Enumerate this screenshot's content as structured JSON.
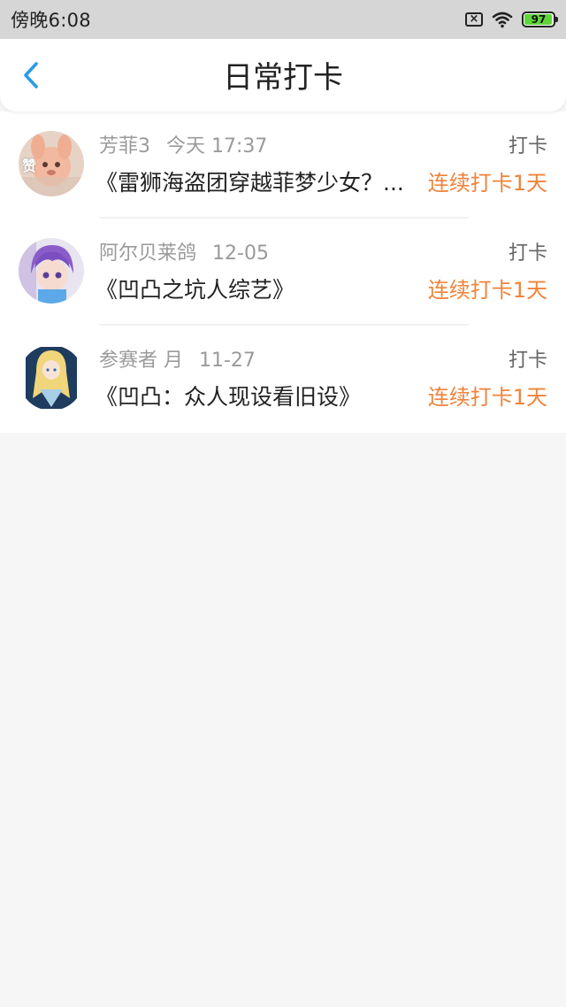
{
  "status_bar": {
    "time": "傍晚6:08",
    "battery_level": "97",
    "battery_fraction": 0.97
  },
  "header": {
    "title": "日常打卡",
    "back_icon": "chevron-left-icon",
    "accent_color": "#2a9be8"
  },
  "items": [
    {
      "user": "芳菲3",
      "date": "今天 17:37",
      "action": "打卡",
      "title": "《雷狮海盗团穿越菲梦少女？...",
      "streak": "连续打卡1天",
      "avatar_badge": "赞"
    },
    {
      "user": "阿尔贝莱鸽",
      "date": "12-05",
      "action": "打卡",
      "title": "《凹凸之坑人综艺》",
      "streak": "连续打卡1天"
    },
    {
      "user": "参赛者 月",
      "date": "11-27",
      "action": "打卡",
      "title": "《凹凸：众人现设看旧设》",
      "streak": "连续打卡1天"
    }
  ],
  "colors": {
    "streak": "#f0833a",
    "meta": "#9a9a9a",
    "background": "#f6f6f6"
  }
}
